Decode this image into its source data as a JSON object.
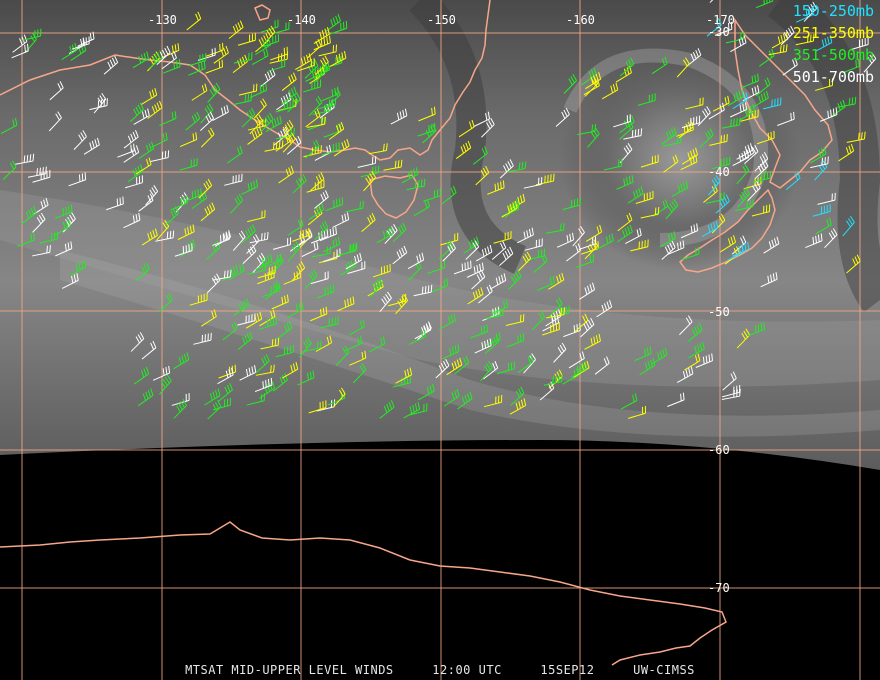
{
  "footer": {
    "text": "MTSAT MID-UPPER LEVEL WINDS     12:00 UTC     15SEP12     UW-CIMSS"
  },
  "legend": [
    {
      "label": "150-250mb",
      "color": "#22e0ff"
    },
    {
      "label": "251-350mb",
      "color": "#ffff00"
    },
    {
      "label": "351-500mb",
      "color": "#22ee22"
    },
    {
      "label": "501-700mb",
      "color": "#ffffff"
    }
  ],
  "grid": {
    "longitudes": [
      "-130",
      "-140",
      "-150",
      "-160",
      "-170"
    ],
    "latitudes": [
      "-30",
      "-40",
      "-50",
      "-60",
      "-70"
    ],
    "line_color": "#f4a985"
  },
  "colors": {
    "coastline": "#f7a68a",
    "background": "#000000"
  }
}
